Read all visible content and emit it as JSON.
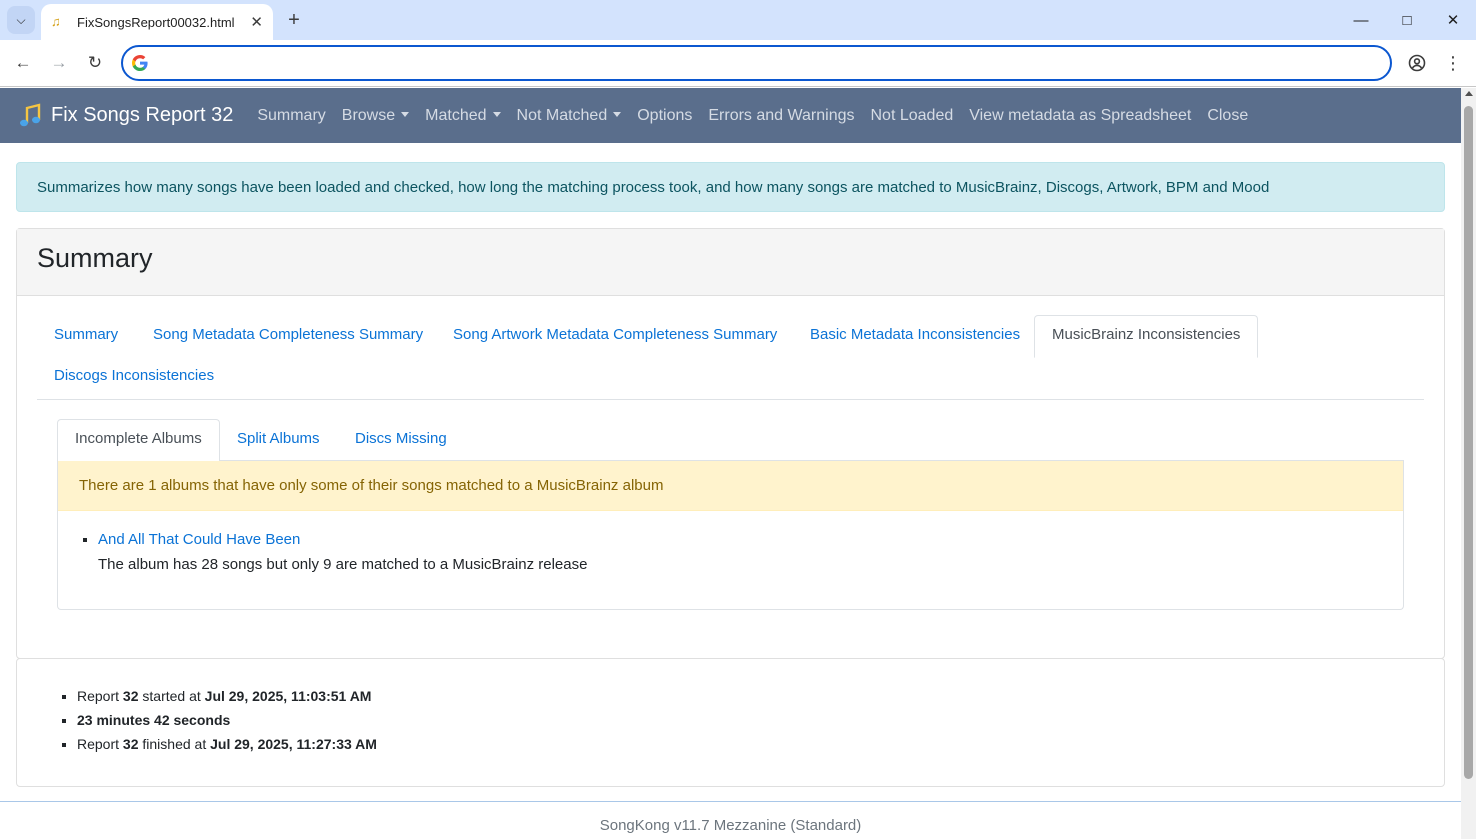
{
  "browser": {
    "tab_title": "FixSongsReport00032.html",
    "new_tab_symbol": "+",
    "address_value": "",
    "window_controls": [
      "minimize",
      "maximize",
      "close"
    ]
  },
  "navbar": {
    "brand": "Fix Songs Report 32",
    "items": [
      {
        "label": "Summary",
        "dropdown": false
      },
      {
        "label": "Browse",
        "dropdown": true
      },
      {
        "label": "Matched",
        "dropdown": true
      },
      {
        "label": "Not Matched",
        "dropdown": true
      },
      {
        "label": "Options",
        "dropdown": false
      },
      {
        "label": "Errors and Warnings",
        "dropdown": false
      },
      {
        "label": "Not Loaded",
        "dropdown": false
      },
      {
        "label": "View metadata as Spreadsheet",
        "dropdown": false
      },
      {
        "label": "Close",
        "dropdown": false
      }
    ]
  },
  "info_alert": "Summarizes how many songs have been loaded and checked, how long the matching process took, and how many songs are matched to MusicBrainz, Discogs, Artwork, BPM and Mood",
  "summary_card": {
    "title": "Summary",
    "tabs": [
      {
        "label": "Summary",
        "active": false
      },
      {
        "label": "Song Metadata Completeness Summary",
        "active": false
      },
      {
        "label": "Song Artwork Metadata Completeness Summary",
        "active": false
      },
      {
        "label": "Basic Metadata Inconsistencies",
        "active": false
      },
      {
        "label": "MusicBrainz Inconsistencies",
        "active": true
      },
      {
        "label": "Discogs Inconsistencies",
        "active": false
      }
    ],
    "inner_tabs": [
      {
        "label": "Incomplete Albums",
        "active": true
      },
      {
        "label": "Split Albums",
        "active": false
      },
      {
        "label": "Discs Missing",
        "active": false
      }
    ],
    "warning": "There are 1 albums that have only some of their songs matched to a MusicBrainz album",
    "albums": [
      {
        "name": "And All That Could Have Been",
        "description": "The album has 28 songs but only 9 are matched to a MusicBrainz release"
      }
    ]
  },
  "report_info": {
    "line1": {
      "prefix": "Report ",
      "number": "32",
      "middle": " started at ",
      "datetime": "Jul 29, 2025, 11:03:51 AM"
    },
    "line2": {
      "duration": "23 minutes 42 seconds"
    },
    "line3": {
      "prefix": "Report ",
      "number": "32",
      "middle": " finished at ",
      "datetime": "Jul 29, 2025, 11:27:33 AM"
    }
  },
  "footer": "SongKong v11.7 Mezzanine (Standard)",
  "colors": {
    "navbar_bg": "#5a6e8c",
    "link": "#0b73d6",
    "info_bg": "#d1ecf1",
    "warning_bg": "#fff3cd"
  }
}
